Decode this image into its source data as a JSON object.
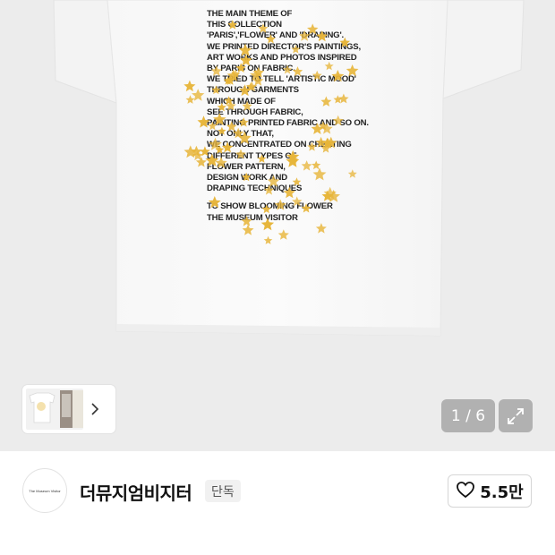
{
  "product_gallery": {
    "print_lines": [
      "THE MAIN THEME OF",
      "THIS COLLECTION",
      "'PARIS','FLOWER' AND 'DRAPING'.",
      "WE PRINTED DIRECTOR'S PAINTINGS,",
      "ART WORKS AND PHOTOS INSPIRED",
      "BY PARIS ON FABRIC.",
      "WE TRIED TO TELL 'ARTISTIC MOOD'",
      "THROUGH GARMENTS",
      "WHICH MADE OF",
      "SEE THROUGH FABRIC,",
      "PAINTING PRINTED FABRIC AND SO ON.",
      "NOT ONLY THAT,",
      "WE CONCENTRATED ON CREATING",
      "DIFFERENT TYPES OF",
      "FLOWER PATTERN,",
      "DESIGN WORK AND",
      "DRAPING TECHNIQUES",
      "",
      "TO SHOW BLOOMING FLOWER",
      "THE MUSEUM VISITOR"
    ],
    "counter": "1 / 6",
    "colors": {
      "background": "#ececec",
      "star": "#e7b53a",
      "overlay": "#828282"
    }
  },
  "seller": {
    "avatar_text": "The Museum Visitor",
    "name": "더뮤지엄비지터",
    "badge": "단독",
    "like_count": "5.5만"
  },
  "icons": [
    "chevron-right-icon",
    "expand-icon",
    "heart-outline-icon"
  ]
}
